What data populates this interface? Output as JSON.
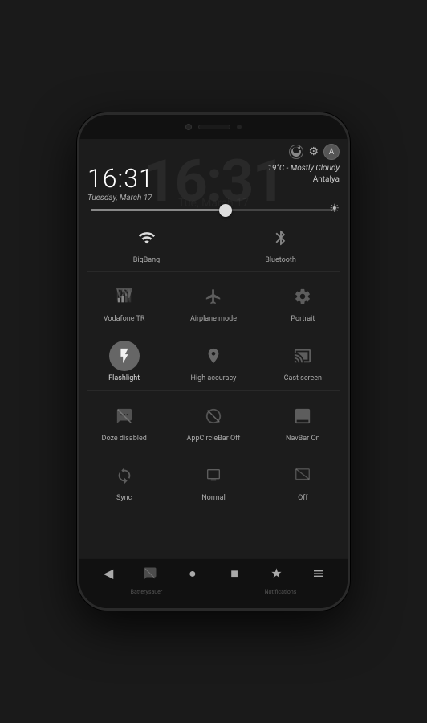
{
  "phone": {
    "clock_watermark": "16:31",
    "date_watermark": "Tue, March 17"
  },
  "status": {
    "settings_icon": "⚙",
    "avatar_label": "A"
  },
  "clock": {
    "time": "16:31",
    "date": "Tuesday, March 17"
  },
  "weather": {
    "temp": "19°C - Mostly Cloudy",
    "location": "Antalya"
  },
  "quick_toggles_row1": [
    {
      "id": "bigbang",
      "label": "BigBang",
      "active": true,
      "icon": "wifi"
    },
    {
      "id": "bluetooth",
      "label": "Bluetooth",
      "active": false,
      "icon": "bt"
    }
  ],
  "quick_toggles_row2": [
    {
      "id": "vodafone",
      "label": "Vodafone TR",
      "active": false,
      "icon": "signal"
    },
    {
      "id": "airplane",
      "label": "Airplane mode",
      "active": false,
      "icon": "airplane"
    },
    {
      "id": "portrait",
      "label": "Portrait",
      "active": false,
      "icon": "portrait"
    }
  ],
  "quick_toggles_row3": [
    {
      "id": "flashlight",
      "label": "Flashlight",
      "active": true,
      "icon": "flash"
    },
    {
      "id": "accuracy",
      "label": "High accuracy",
      "active": false,
      "icon": "location"
    },
    {
      "id": "cast",
      "label": "Cast screen",
      "active": false,
      "icon": "cast"
    }
  ],
  "quick_toggles_row4": [
    {
      "id": "doze",
      "label": "Doze disabled",
      "active": false,
      "icon": "doze"
    },
    {
      "id": "appcircle",
      "label": "AppCircleBar Off",
      "active": false,
      "icon": "appcircle"
    },
    {
      "id": "navbar",
      "label": "NavBar On",
      "active": false,
      "icon": "navbar"
    }
  ],
  "quick_toggles_row5": [
    {
      "id": "sync",
      "label": "Sync",
      "active": false,
      "icon": "sync"
    },
    {
      "id": "normal",
      "label": "Normal",
      "active": false,
      "icon": "normal"
    },
    {
      "id": "off",
      "label": "Off",
      "active": false,
      "icon": "off"
    }
  ],
  "nav": {
    "back_icon": "◀",
    "star_icon": "★",
    "menu_icon": "☰",
    "home_icon": "●",
    "recent_icon": "■"
  },
  "bottom_labels": {
    "left": "Batterysauer",
    "right": "Notifications"
  }
}
